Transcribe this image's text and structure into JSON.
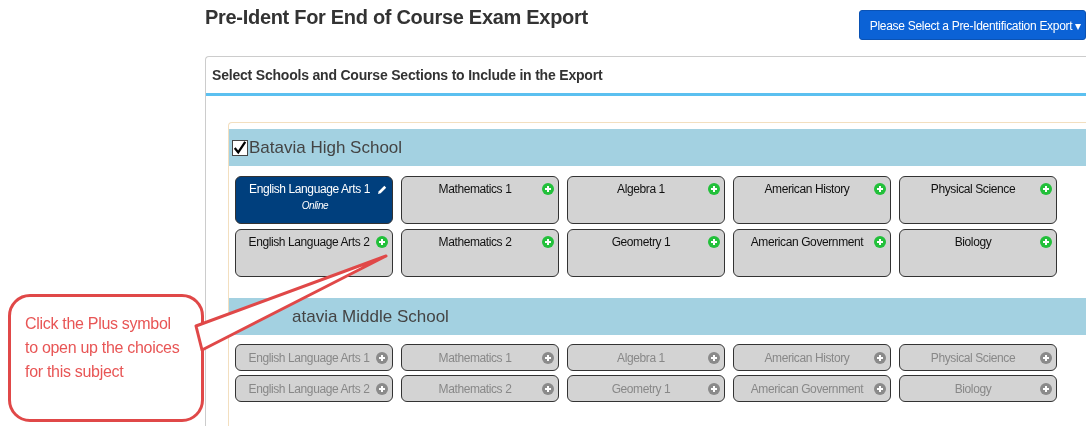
{
  "title": "Pre-Ident For End of Course Exam Export",
  "export_button": {
    "label": "Please Select a Pre-Identification Export",
    "caret": "▾"
  },
  "panel": {
    "heading": "Select Schools and Course Sections to Include in the Export",
    "schools": [
      {
        "name": "Batavia High School",
        "checked": true,
        "courses": [
          {
            "label": "English Language Arts 1",
            "sublabel": "Online",
            "selected": true,
            "disabled": false
          },
          {
            "label": "Mathematics 1",
            "selected": false,
            "disabled": false
          },
          {
            "label": "Algebra 1",
            "selected": false,
            "disabled": false
          },
          {
            "label": "American History",
            "selected": false,
            "disabled": false
          },
          {
            "label": "Physical Science",
            "selected": false,
            "disabled": false
          },
          {
            "label": "English Language Arts 2",
            "selected": false,
            "disabled": false
          },
          {
            "label": "Mathematics 2",
            "selected": false,
            "disabled": false
          },
          {
            "label": "Geometry 1",
            "selected": false,
            "disabled": false
          },
          {
            "label": "American Government",
            "selected": false,
            "disabled": false
          },
          {
            "label": "Biology",
            "selected": false,
            "disabled": false
          }
        ]
      },
      {
        "name": "atavia Middle School",
        "courses": [
          {
            "label": "English Language Arts 1",
            "selected": false,
            "disabled": true
          },
          {
            "label": "Mathematics 1",
            "selected": false,
            "disabled": true
          },
          {
            "label": "Algebra 1",
            "selected": false,
            "disabled": true
          },
          {
            "label": "American History",
            "selected": false,
            "disabled": true
          },
          {
            "label": "Physical Science",
            "selected": false,
            "disabled": true
          },
          {
            "label": "English Language Arts 2",
            "selected": false,
            "disabled": true
          },
          {
            "label": "Mathematics 2",
            "selected": false,
            "disabled": true
          },
          {
            "label": "Geometry 1",
            "selected": false,
            "disabled": true
          },
          {
            "label": "American Government",
            "selected": false,
            "disabled": true
          },
          {
            "label": "Biology",
            "selected": false,
            "disabled": true
          }
        ]
      }
    ]
  },
  "callout": {
    "text": "Click the Plus symbol to open up the choices for this subject"
  }
}
